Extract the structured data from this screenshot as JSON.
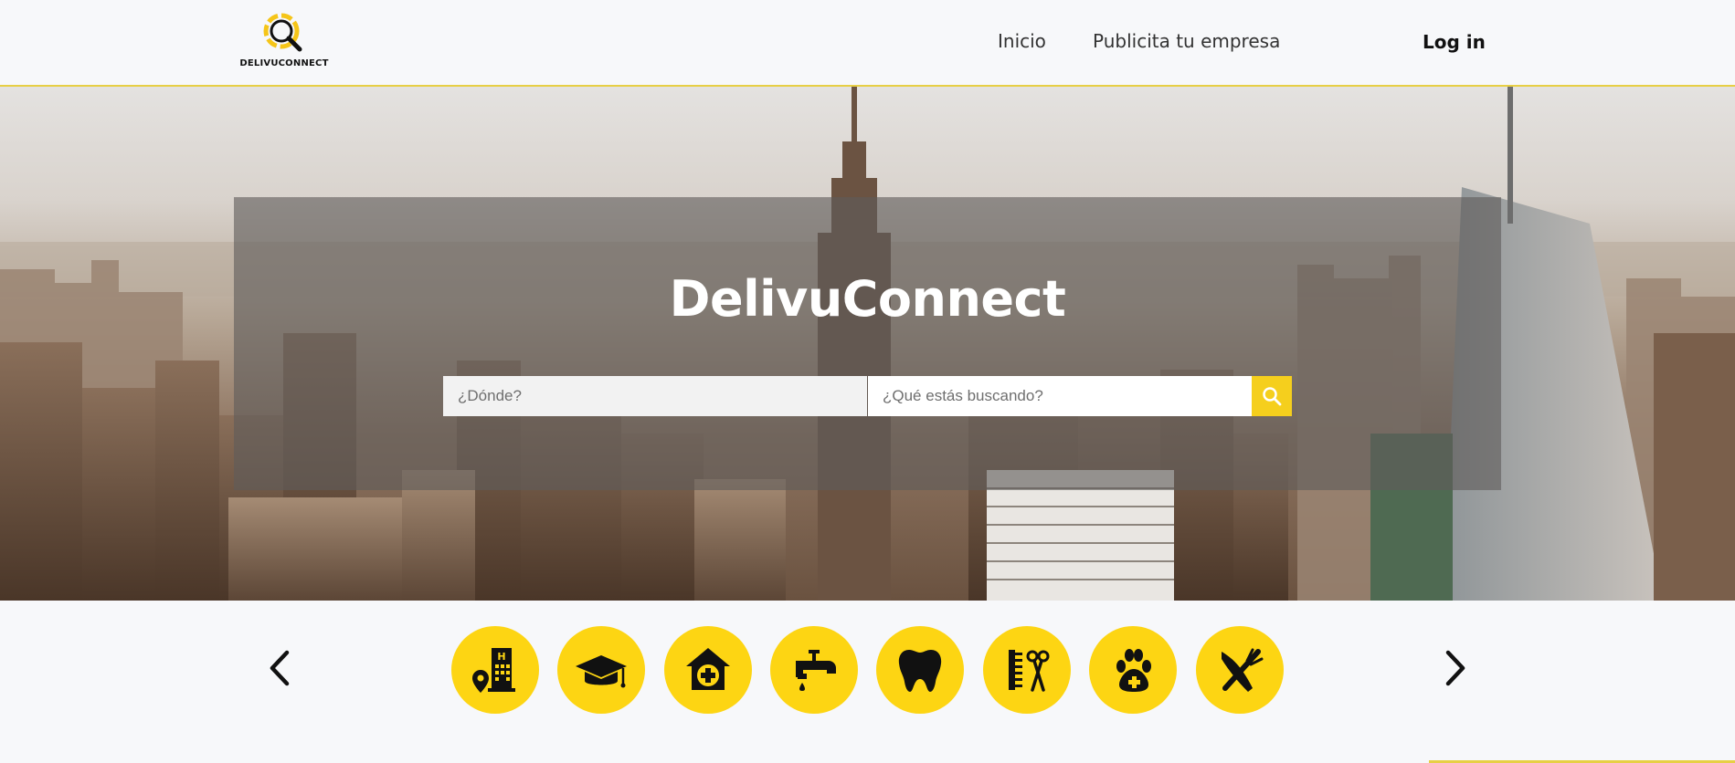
{
  "header": {
    "logo_text": "DELIVUCONNECT",
    "nav": {
      "inicio": "Inicio",
      "publicita": "Publicita tu empresa"
    },
    "login": "Log in"
  },
  "hero": {
    "title": "DelivuConnect",
    "search": {
      "where_placeholder": "¿Dónde?",
      "what_placeholder": "¿Qué estás buscando?",
      "button_icon": "search-icon"
    }
  },
  "categories": {
    "prev_icon": "chevron-left-icon",
    "next_icon": "chevron-right-icon",
    "items": [
      {
        "icon": "hotel-location-icon"
      },
      {
        "icon": "graduation-cap-icon"
      },
      {
        "icon": "medical-clinic-icon"
      },
      {
        "icon": "water-faucet-icon"
      },
      {
        "icon": "tooth-icon"
      },
      {
        "icon": "comb-scissors-icon"
      },
      {
        "icon": "paw-clinic-icon"
      },
      {
        "icon": "fork-knife-icon"
      }
    ]
  },
  "colors": {
    "accent": "#fdd513",
    "header_border": "#e7cf45",
    "page_bg": "#f7f8fa",
    "text_dark": "#111111"
  }
}
